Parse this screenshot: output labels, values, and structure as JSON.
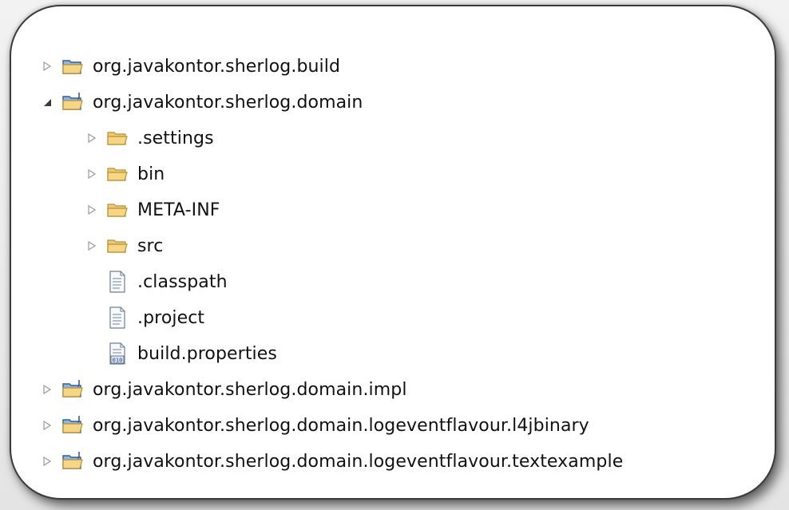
{
  "tree": {
    "items": [
      {
        "label": "org.javakontor.sherlog.build",
        "type": "folder-project",
        "toggle": "collapsed"
      },
      {
        "label": "org.javakontor.sherlog.domain",
        "type": "java-project",
        "toggle": "expanded"
      },
      {
        "label": ".settings",
        "type": "folder",
        "toggle": "collapsed"
      },
      {
        "label": "bin",
        "type": "folder",
        "toggle": "collapsed"
      },
      {
        "label": "META-INF",
        "type": "folder",
        "toggle": "collapsed"
      },
      {
        "label": "src",
        "type": "folder",
        "toggle": "collapsed"
      },
      {
        "label": ".classpath",
        "type": "text-file",
        "toggle": "none"
      },
      {
        "label": ".project",
        "type": "text-file",
        "toggle": "none"
      },
      {
        "label": "build.properties",
        "type": "binary-file",
        "toggle": "none"
      },
      {
        "label": "org.javakontor.sherlog.domain.impl",
        "type": "java-project",
        "toggle": "collapsed"
      },
      {
        "label": "org.javakontor.sherlog.domain.logeventflavour.l4jbinary",
        "type": "java-project",
        "toggle": "collapsed"
      },
      {
        "label": "org.javakontor.sherlog.domain.logeventflavour.textexample",
        "type": "java-project",
        "toggle": "collapsed"
      }
    ]
  },
  "colors": {
    "folder_fill": "#f6d684",
    "folder_stroke": "#b8902f",
    "project_fill": "#8fb7e6",
    "project_stroke": "#2f5f9e",
    "toggle": "#9a9a9a",
    "toggle_expanded": "#3a3a3a"
  }
}
